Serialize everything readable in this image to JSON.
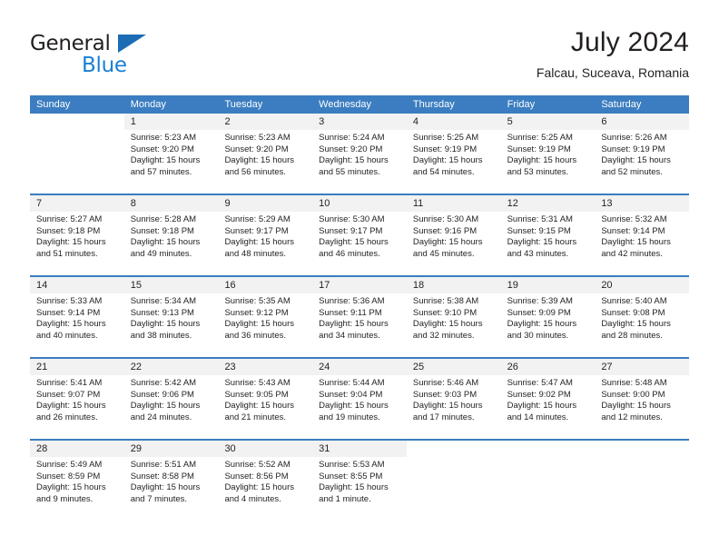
{
  "brand": {
    "name_top": "General",
    "name_bottom": "Blue",
    "triangle_color": "#1b6cb5",
    "text_color": "#231f20",
    "blue_color": "#1b7fd4"
  },
  "header": {
    "title": "July 2024",
    "subtitle": "Falcau, Suceava, Romania"
  },
  "colors": {
    "header_blue": "#3b7dc0",
    "row_divider_blue": "#3b7dc0",
    "daynum_band": "#f2f2f2",
    "text": "#231f20",
    "page_background": "#ffffff"
  },
  "labels": {
    "sunrise_prefix": "Sunrise:",
    "sunset_prefix": "Sunset:",
    "daylight_prefix": "Daylight:"
  },
  "weekdays": [
    "Sunday",
    "Monday",
    "Tuesday",
    "Wednesday",
    "Thursday",
    "Friday",
    "Saturday"
  ],
  "weeks": [
    [
      {
        "day": "",
        "sunrise": "",
        "sunset": "",
        "daylight1": "",
        "daylight2": ""
      },
      {
        "day": "1",
        "sunrise": "Sunrise: 5:23 AM",
        "sunset": "Sunset: 9:20 PM",
        "daylight1": "Daylight: 15 hours",
        "daylight2": "and 57 minutes."
      },
      {
        "day": "2",
        "sunrise": "Sunrise: 5:23 AM",
        "sunset": "Sunset: 9:20 PM",
        "daylight1": "Daylight: 15 hours",
        "daylight2": "and 56 minutes."
      },
      {
        "day": "3",
        "sunrise": "Sunrise: 5:24 AM",
        "sunset": "Sunset: 9:20 PM",
        "daylight1": "Daylight: 15 hours",
        "daylight2": "and 55 minutes."
      },
      {
        "day": "4",
        "sunrise": "Sunrise: 5:25 AM",
        "sunset": "Sunset: 9:19 PM",
        "daylight1": "Daylight: 15 hours",
        "daylight2": "and 54 minutes."
      },
      {
        "day": "5",
        "sunrise": "Sunrise: 5:25 AM",
        "sunset": "Sunset: 9:19 PM",
        "daylight1": "Daylight: 15 hours",
        "daylight2": "and 53 minutes."
      },
      {
        "day": "6",
        "sunrise": "Sunrise: 5:26 AM",
        "sunset": "Sunset: 9:19 PM",
        "daylight1": "Daylight: 15 hours",
        "daylight2": "and 52 minutes."
      }
    ],
    [
      {
        "day": "7",
        "sunrise": "Sunrise: 5:27 AM",
        "sunset": "Sunset: 9:18 PM",
        "daylight1": "Daylight: 15 hours",
        "daylight2": "and 51 minutes."
      },
      {
        "day": "8",
        "sunrise": "Sunrise: 5:28 AM",
        "sunset": "Sunset: 9:18 PM",
        "daylight1": "Daylight: 15 hours",
        "daylight2": "and 49 minutes."
      },
      {
        "day": "9",
        "sunrise": "Sunrise: 5:29 AM",
        "sunset": "Sunset: 9:17 PM",
        "daylight1": "Daylight: 15 hours",
        "daylight2": "and 48 minutes."
      },
      {
        "day": "10",
        "sunrise": "Sunrise: 5:30 AM",
        "sunset": "Sunset: 9:17 PM",
        "daylight1": "Daylight: 15 hours",
        "daylight2": "and 46 minutes."
      },
      {
        "day": "11",
        "sunrise": "Sunrise: 5:30 AM",
        "sunset": "Sunset: 9:16 PM",
        "daylight1": "Daylight: 15 hours",
        "daylight2": "and 45 minutes."
      },
      {
        "day": "12",
        "sunrise": "Sunrise: 5:31 AM",
        "sunset": "Sunset: 9:15 PM",
        "daylight1": "Daylight: 15 hours",
        "daylight2": "and 43 minutes."
      },
      {
        "day": "13",
        "sunrise": "Sunrise: 5:32 AM",
        "sunset": "Sunset: 9:14 PM",
        "daylight1": "Daylight: 15 hours",
        "daylight2": "and 42 minutes."
      }
    ],
    [
      {
        "day": "14",
        "sunrise": "Sunrise: 5:33 AM",
        "sunset": "Sunset: 9:14 PM",
        "daylight1": "Daylight: 15 hours",
        "daylight2": "and 40 minutes."
      },
      {
        "day": "15",
        "sunrise": "Sunrise: 5:34 AM",
        "sunset": "Sunset: 9:13 PM",
        "daylight1": "Daylight: 15 hours",
        "daylight2": "and 38 minutes."
      },
      {
        "day": "16",
        "sunrise": "Sunrise: 5:35 AM",
        "sunset": "Sunset: 9:12 PM",
        "daylight1": "Daylight: 15 hours",
        "daylight2": "and 36 minutes."
      },
      {
        "day": "17",
        "sunrise": "Sunrise: 5:36 AM",
        "sunset": "Sunset: 9:11 PM",
        "daylight1": "Daylight: 15 hours",
        "daylight2": "and 34 minutes."
      },
      {
        "day": "18",
        "sunrise": "Sunrise: 5:38 AM",
        "sunset": "Sunset: 9:10 PM",
        "daylight1": "Daylight: 15 hours",
        "daylight2": "and 32 minutes."
      },
      {
        "day": "19",
        "sunrise": "Sunrise: 5:39 AM",
        "sunset": "Sunset: 9:09 PM",
        "daylight1": "Daylight: 15 hours",
        "daylight2": "and 30 minutes."
      },
      {
        "day": "20",
        "sunrise": "Sunrise: 5:40 AM",
        "sunset": "Sunset: 9:08 PM",
        "daylight1": "Daylight: 15 hours",
        "daylight2": "and 28 minutes."
      }
    ],
    [
      {
        "day": "21",
        "sunrise": "Sunrise: 5:41 AM",
        "sunset": "Sunset: 9:07 PM",
        "daylight1": "Daylight: 15 hours",
        "daylight2": "and 26 minutes."
      },
      {
        "day": "22",
        "sunrise": "Sunrise: 5:42 AM",
        "sunset": "Sunset: 9:06 PM",
        "daylight1": "Daylight: 15 hours",
        "daylight2": "and 24 minutes."
      },
      {
        "day": "23",
        "sunrise": "Sunrise: 5:43 AM",
        "sunset": "Sunset: 9:05 PM",
        "daylight1": "Daylight: 15 hours",
        "daylight2": "and 21 minutes."
      },
      {
        "day": "24",
        "sunrise": "Sunrise: 5:44 AM",
        "sunset": "Sunset: 9:04 PM",
        "daylight1": "Daylight: 15 hours",
        "daylight2": "and 19 minutes."
      },
      {
        "day": "25",
        "sunrise": "Sunrise: 5:46 AM",
        "sunset": "Sunset: 9:03 PM",
        "daylight1": "Daylight: 15 hours",
        "daylight2": "and 17 minutes."
      },
      {
        "day": "26",
        "sunrise": "Sunrise: 5:47 AM",
        "sunset": "Sunset: 9:02 PM",
        "daylight1": "Daylight: 15 hours",
        "daylight2": "and 14 minutes."
      },
      {
        "day": "27",
        "sunrise": "Sunrise: 5:48 AM",
        "sunset": "Sunset: 9:00 PM",
        "daylight1": "Daylight: 15 hours",
        "daylight2": "and 12 minutes."
      }
    ],
    [
      {
        "day": "28",
        "sunrise": "Sunrise: 5:49 AM",
        "sunset": "Sunset: 8:59 PM",
        "daylight1": "Daylight: 15 hours",
        "daylight2": "and 9 minutes."
      },
      {
        "day": "29",
        "sunrise": "Sunrise: 5:51 AM",
        "sunset": "Sunset: 8:58 PM",
        "daylight1": "Daylight: 15 hours",
        "daylight2": "and 7 minutes."
      },
      {
        "day": "30",
        "sunrise": "Sunrise: 5:52 AM",
        "sunset": "Sunset: 8:56 PM",
        "daylight1": "Daylight: 15 hours",
        "daylight2": "and 4 minutes."
      },
      {
        "day": "31",
        "sunrise": "Sunrise: 5:53 AM",
        "sunset": "Sunset: 8:55 PM",
        "daylight1": "Daylight: 15 hours",
        "daylight2": "and 1 minute."
      },
      {
        "day": "",
        "sunrise": "",
        "sunset": "",
        "daylight1": "",
        "daylight2": ""
      },
      {
        "day": "",
        "sunrise": "",
        "sunset": "",
        "daylight1": "",
        "daylight2": ""
      },
      {
        "day": "",
        "sunrise": "",
        "sunset": "",
        "daylight1": "",
        "daylight2": ""
      }
    ]
  ]
}
